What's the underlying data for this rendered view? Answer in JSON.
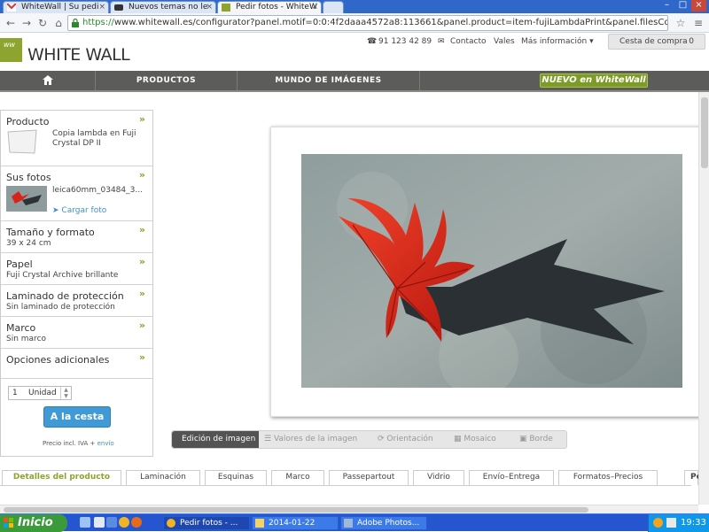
{
  "browser": {
    "tabs": [
      {
        "label": "WhiteWall | Su pedi",
        "favicon": "gmail-icon"
      },
      {
        "label": "Nuevos temas no le",
        "favicon": "forum-icon"
      },
      {
        "label": "Pedir fotos - WhiteW",
        "favicon": "whitewall-icon",
        "active": true
      }
    ],
    "url_scheme": "https://",
    "url_rest": "www.whitewall.es/configurator?panel.motif=0:0:4f2daaa4572a8:113661&panel.product=item-fujiLambdaPrint&panel.filesCount=1",
    "window_controls": [
      "–",
      "□",
      "×"
    ]
  },
  "site": {
    "logo_mark": "ww",
    "brand": "WHITE WALL",
    "phone": "91 123 42 89",
    "contact": "Contacto",
    "vales": "Vales",
    "more_info": "Más información",
    "cart_label": "Cesta de compra",
    "cart_count": "0",
    "nav": {
      "productos": "PRODUCTOS",
      "mundo": "MUNDO DE IMÁGENES",
      "nuevo": "NUEVO en WhiteWall"
    }
  },
  "sidebar": {
    "producto": {
      "title": "Producto",
      "text": "Copia lambda en Fuji Crystal DP II"
    },
    "fotos": {
      "title": "Sus fotos",
      "filename": "leica60mm_03484_3...",
      "upload": "Cargar foto"
    },
    "tamano": {
      "title": "Tamaño y formato",
      "value": "39 x 24 cm"
    },
    "papel": {
      "title": "Papel",
      "value": "Fuji Crystal Archive brillante"
    },
    "laminado": {
      "title": "Laminado de protección",
      "value": "Sin laminado de protección"
    },
    "marco": {
      "title": "Marco",
      "value": "Sin marco"
    },
    "opciones": {
      "title": "Opciones adicionales"
    },
    "quantity": "1",
    "unit": "Unidad",
    "add_to_cart": "A la cesta",
    "price_note": "Precio incl. IVA +",
    "shipping_link": "envío"
  },
  "editor": {
    "tools": [
      "Edición de imagen",
      "Valores de la imagen",
      "Orientación",
      "Mosaico",
      "Borde"
    ]
  },
  "details_tabs": [
    "Detalles del producto",
    "Laminación",
    "Esquinas",
    "Marco",
    "Passepartout",
    "Vidrio",
    "Envío–Entrega",
    "Formatos–Precios"
  ],
  "details_extra": "Pe",
  "taskbar": {
    "start": "Inicio",
    "items": [
      "Pedir fotos - ...",
      "2014-01-22",
      "Adobe Photos..."
    ],
    "clock": "19:33"
  }
}
